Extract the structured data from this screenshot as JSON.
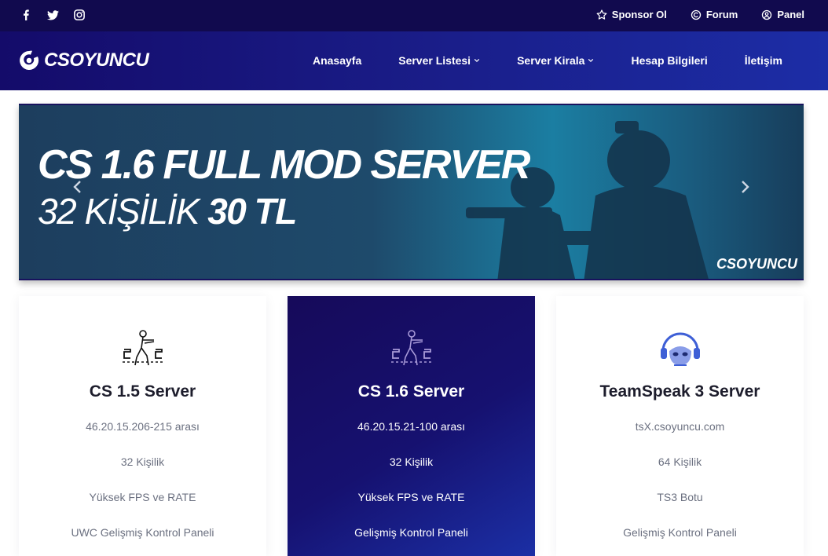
{
  "topbar": {
    "social": [
      {
        "icon": "facebook-icon"
      },
      {
        "icon": "twitter-icon"
      },
      {
        "icon": "instagram-icon"
      }
    ],
    "links": [
      {
        "label": "Sponsor Ol",
        "icon": "star-icon"
      },
      {
        "label": "Forum",
        "icon": "forum-icon"
      },
      {
        "label": "Panel",
        "icon": "panel-icon"
      }
    ]
  },
  "nav": {
    "logo": "CSOYUNCU",
    "items": [
      {
        "label": "Anasayfa"
      },
      {
        "label": "Server Listesi"
      },
      {
        "label": "Server Kirala"
      },
      {
        "label": "Hesap Bilgileri"
      },
      {
        "label": "İletişim"
      }
    ]
  },
  "banner": {
    "line1": "CS 1.6 FULL MOD SERVER",
    "line2_prefix": "32 KİŞİLİK",
    "line2_price": "30 TL",
    "brand": "CSOYUNCU"
  },
  "cards": [
    {
      "title": "CS 1.5 Server",
      "icon": "counter-strike-icon",
      "features": [
        "46.20.15.206-215 arası",
        "32 Kişilik",
        "Yüksek FPS ve RATE",
        "UWC Gelişmiş Kontrol Paneli"
      ]
    },
    {
      "title": "CS 1.6 Server",
      "icon": "counter-strike-icon",
      "features": [
        "46.20.15.21-100 arası",
        "32 Kişilik",
        "Yüksek FPS ve RATE",
        "Gelişmiş Kontrol Paneli"
      ]
    },
    {
      "title": "TeamSpeak 3 Server",
      "icon": "teamspeak-icon",
      "features": [
        "tsX.csoyuncu.com",
        "64 Kişilik",
        "TS3 Botu",
        "Gelişmiş Kontrol Paneli"
      ]
    }
  ],
  "colors": {
    "topbar": "#110a4e",
    "nav_start": "#140b6a",
    "nav_end": "#1c2da6",
    "highlight_card": "#161170"
  }
}
